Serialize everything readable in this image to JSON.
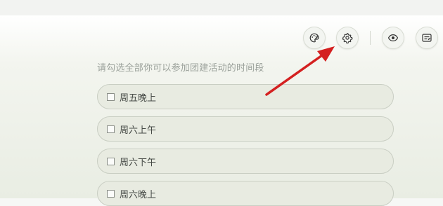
{
  "toolbar": {
    "buttons": [
      {
        "name": "theme-button",
        "icon": "palette-icon"
      },
      {
        "name": "settings-button",
        "icon": "gear-icon"
      },
      {
        "name": "preview-button",
        "icon": "eye-icon"
      },
      {
        "name": "form-button",
        "icon": "form-icon"
      }
    ]
  },
  "question": {
    "title": "请勾选全部你可以参加团建活动的时间段",
    "options": [
      {
        "label": "周五晚上",
        "checked": false
      },
      {
        "label": "周六上午",
        "checked": false
      },
      {
        "label": "周六下午",
        "checked": false
      },
      {
        "label": "周六晚上",
        "checked": false
      }
    ]
  },
  "annotation": {
    "color": "#d42020",
    "points_to": "settings-button"
  }
}
